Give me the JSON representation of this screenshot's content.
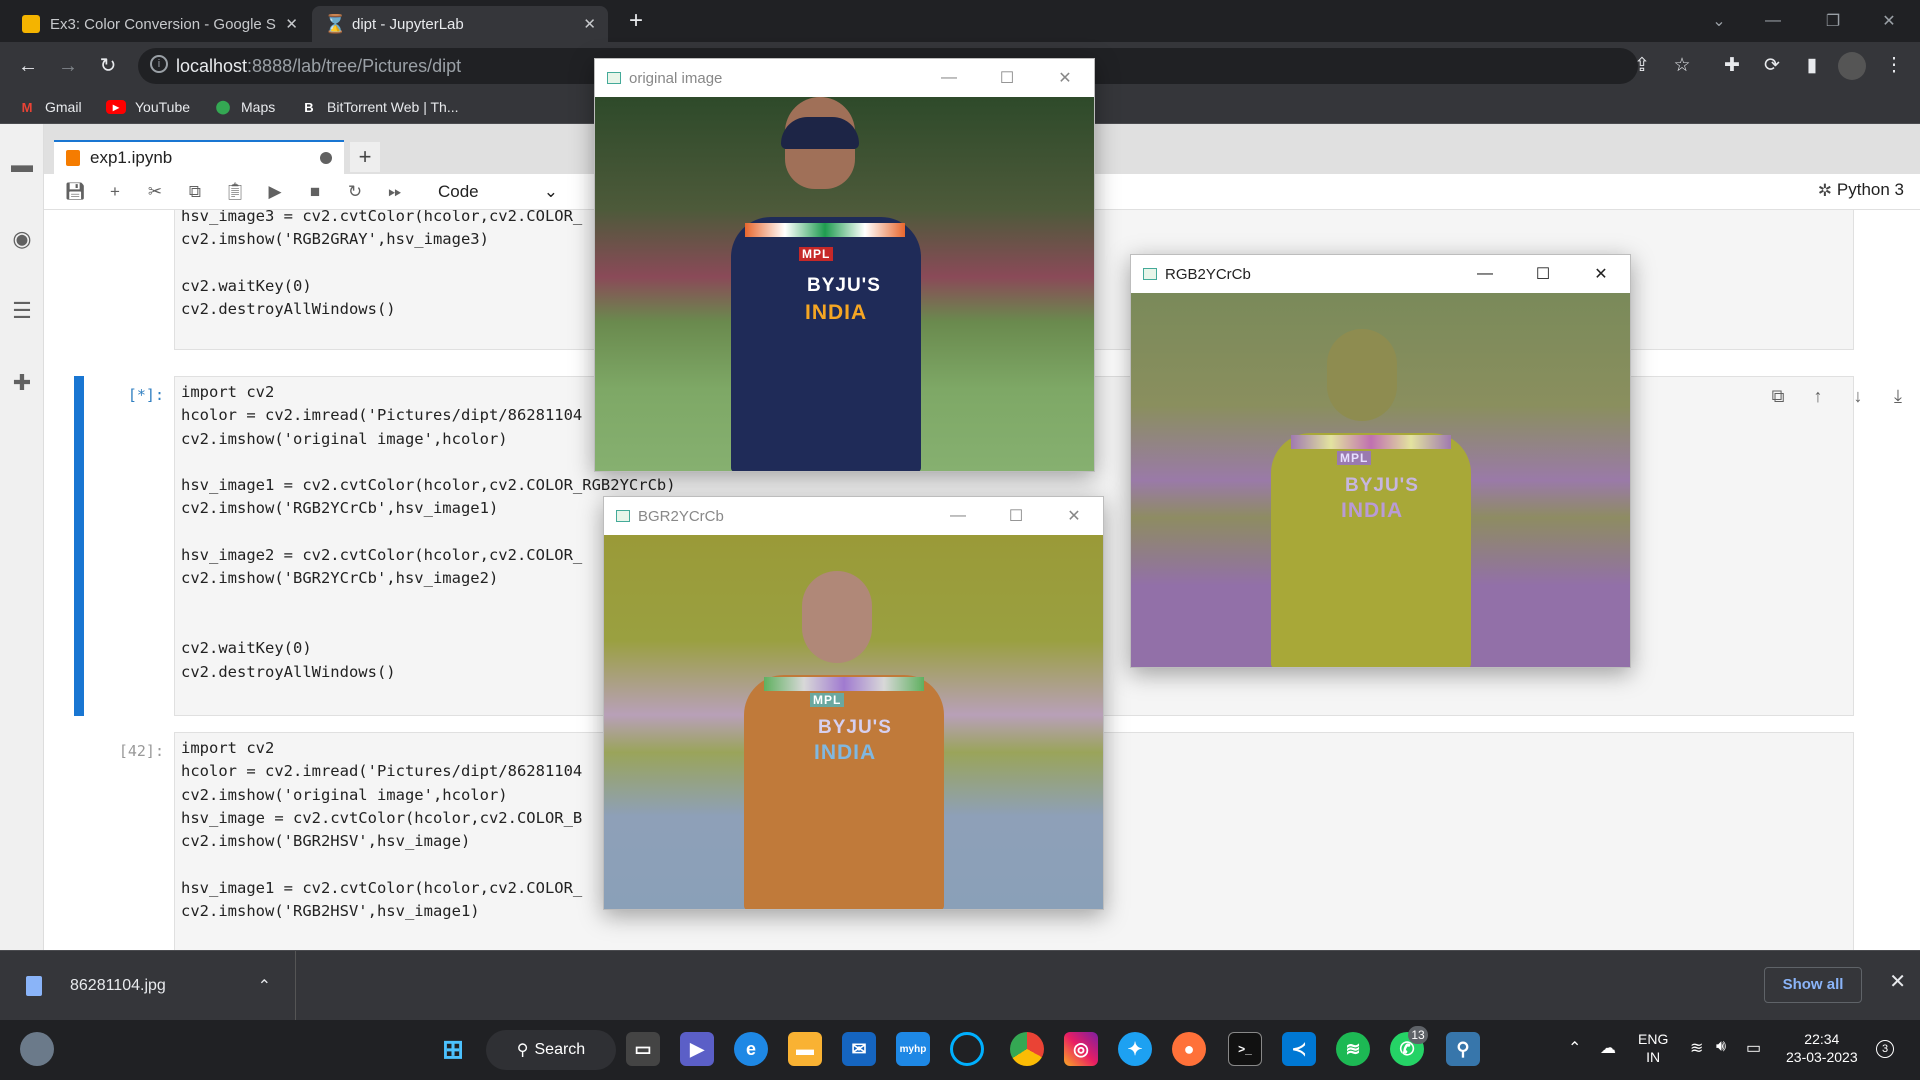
{
  "browser": {
    "tabs": [
      {
        "title": "Ex3: Color Conversion - Google S",
        "active": false
      },
      {
        "title": "dipt - JupyterLab",
        "active": true
      }
    ],
    "url_host": "localhost",
    "url_path": ":8888/lab/tree/Pictures/dipt",
    "bookmarks": [
      "Gmail",
      "YouTube",
      "Maps",
      "BitTorrent Web | Th..."
    ]
  },
  "jupyter": {
    "notebook_tab": "exp1.ipynb",
    "cell_type": "Code",
    "kernel": "Python 3",
    "cells": [
      {
        "prompt": "",
        "code": "hsv_image3 = cv2.cvtColor(hcolor,cv2.COLOR_\ncv2.imshow('RGB2GRAY',hsv_image3)\n\ncv2.waitKey(0)\ncv2.destroyAllWindows()"
      },
      {
        "prompt": "[*]:",
        "code": "import cv2\nhcolor = cv2.imread('Pictures/dipt/86281104\ncv2.imshow('original image',hcolor)\n\nhsv_image1 = cv2.cvtColor(hcolor,cv2.COLOR_RGB2YCrCb)\ncv2.imshow('RGB2YCrCb',hsv_image1)\n\nhsv_image2 = cv2.cvtColor(hcolor,cv2.COLOR_\ncv2.imshow('BGR2YCrCb',hsv_image2)\n\n\ncv2.waitKey(0)\ncv2.destroyAllWindows()"
      },
      {
        "prompt": "[42]:",
        "code": "import cv2\nhcolor = cv2.imread('Pictures/dipt/86281104\ncv2.imshow('original image',hcolor)\nhsv_image = cv2.cvtColor(hcolor,cv2.COLOR_B\ncv2.imshow('BGR2HSV',hsv_image)\n\nhsv_image1 = cv2.cvtColor(hcolor,cv2.COLOR_\ncv2.imshow('RGB2HSV',hsv_image1)"
      }
    ]
  },
  "windows": [
    {
      "title": "original image",
      "jersey_sponsor": "BYJU'S",
      "jersey_text": "INDIA",
      "badge": "MPL"
    },
    {
      "title": "RGB2YCrCb",
      "jersey_sponsor": "BYJU'S",
      "jersey_text": "INDIA",
      "badge": "MPL"
    },
    {
      "title": "BGR2YCrCb",
      "jersey_sponsor": "BYJU'S",
      "jersey_text": "INDIA",
      "badge": "MPL"
    }
  ],
  "downloads": {
    "filename": "86281104.jpg",
    "show_all": "Show all"
  },
  "taskbar": {
    "search": "Search",
    "whatsapp_badge": "13",
    "lang_top": "ENG",
    "lang_bottom": "IN",
    "time": "22:34",
    "date": "23-03-2023",
    "notification_count": "3"
  }
}
